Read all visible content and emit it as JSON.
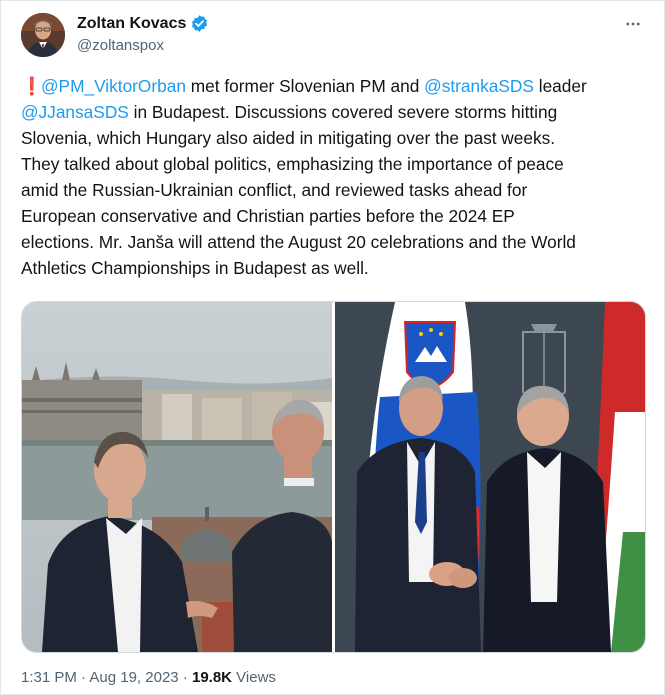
{
  "author": {
    "display_name": "Zoltan Kovacs",
    "handle": "@zoltanspox",
    "verified_color": "#1d9bf0"
  },
  "more_icon": "more-horizontal-icon",
  "tweet": {
    "exclamation": "❗",
    "segments": [
      {
        "text": "@PM_ViktorOrban",
        "link": true
      },
      {
        "text": " met former Slovenian PM and ",
        "link": false
      },
      {
        "text": "@strankaSDS",
        "link": true
      },
      {
        "text": " leader",
        "link": false
      },
      {
        "text": "@JJansaSDS",
        "link": true
      },
      {
        "text": " in Budapest. Discussions covered severe storms hitting",
        "link": false
      },
      {
        "text": "Slovenia, which Hungary also aided in mitigating over the past weeks.",
        "link": false
      },
      {
        "text": "They talked about global politics, emphasizing the importance of peace",
        "link": false
      },
      {
        "text": "amid the Russian-Ukrainian conflict, and reviewed tasks ahead for",
        "link": false
      },
      {
        "text": "European conservative and Christian parties before the 2024 EP",
        "link": false
      },
      {
        "text": "elections. Mr. Janša will attend the August 20 celebrations and the World",
        "link": false
      },
      {
        "text": "Athletics Championships in Budapest as well.",
        "link": false
      }
    ]
  },
  "meta": {
    "time": "1:31 PM",
    "separator": " · ",
    "date": "Aug 19, 2023",
    "views_count": "19.8K",
    "views_label": " Views"
  },
  "colors": {
    "link": "#1d9bf0",
    "secondary_text": "#536471",
    "primary_text": "#0f1419",
    "border": "#cfd9de"
  }
}
